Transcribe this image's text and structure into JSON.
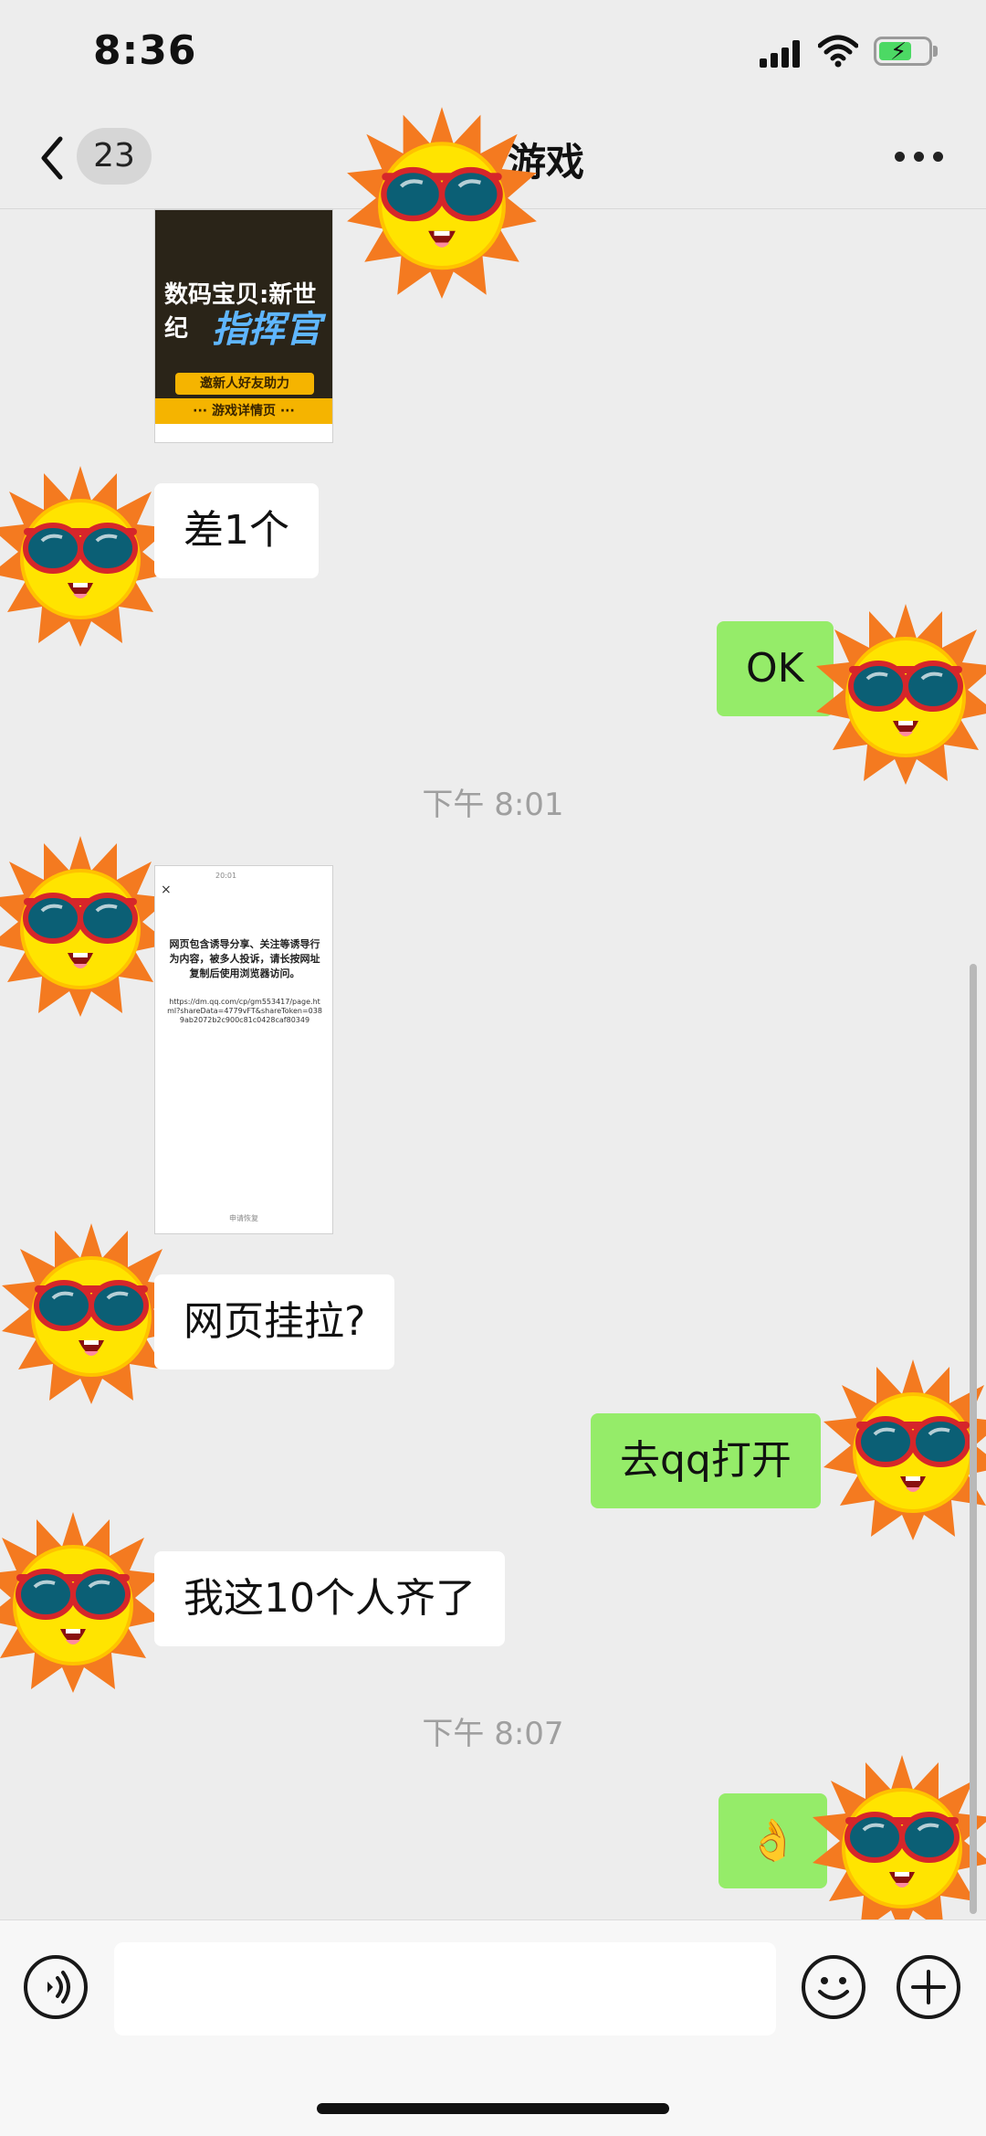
{
  "status_bar": {
    "time": "8:36"
  },
  "nav": {
    "unread_count": "23",
    "title": "游戏"
  },
  "messages": {
    "game_card": {
      "title1": "数码宝贝:新世纪",
      "title2": "指挥官",
      "button1": "邀新人好友助力",
      "button2": "··· 游戏详情页 ···"
    },
    "m1": "差1个",
    "m2": "OK",
    "time1": "下午 8:01",
    "web_card": {
      "status": "20:01",
      "close": "×",
      "text": "网页包含诱导分享、关注等诱导行为内容，被多人投诉，请长按网址复制后使用浏览器访问。",
      "url": "https://dm.qq.com/cp/gm553417/page.html?shareData=4779vFT&shareToken=0389ab2072b2c900c81c0428caf80349",
      "footer": "申请恢复"
    },
    "m3": "网页挂拉?",
    "m4": "去qq打开",
    "m5": "我这10个人齐了",
    "time2": "下午 8:07",
    "m6": "👌"
  },
  "icons": {
    "avatar": "sun-with-sunglasses-icon",
    "back": "chevron-left-icon",
    "more": "more-dots-icon",
    "voice": "voice-icon",
    "emoji": "smiley-icon",
    "plus": "plus-icon"
  },
  "colors": {
    "background": "#ededed",
    "sent_bubble": "#95ec69",
    "received_bubble": "#ffffff"
  }
}
